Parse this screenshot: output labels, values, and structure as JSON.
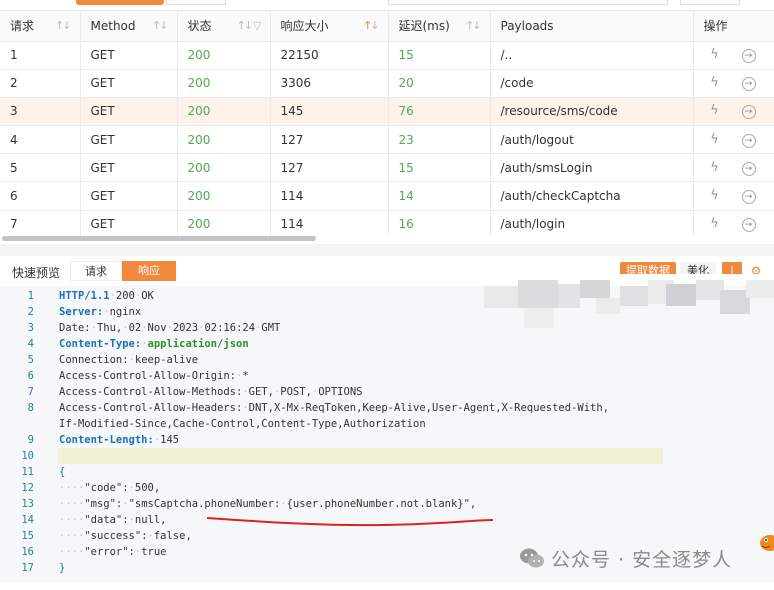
{
  "table": {
    "columns": [
      {
        "label": "请求",
        "sort": true,
        "filter": false
      },
      {
        "label": "Method",
        "sort": true,
        "filter": false
      },
      {
        "label": "状态",
        "sort": true,
        "filter": true
      },
      {
        "label": "响应大小",
        "sort": true,
        "filter": false,
        "sort_active": true
      },
      {
        "label": "延迟(ms)",
        "sort": true,
        "filter": false
      },
      {
        "label": "Payloads",
        "sort": false,
        "filter": false
      },
      {
        "label": "操作",
        "sort": false,
        "filter": false
      }
    ],
    "rows": [
      {
        "id": "1",
        "method": "GET",
        "status": "200",
        "size": "22150",
        "latency": "15",
        "payload": "/.."
      },
      {
        "id": "2",
        "method": "GET",
        "status": "200",
        "size": "3306",
        "latency": "20",
        "payload": "/code"
      },
      {
        "id": "3",
        "method": "GET",
        "status": "200",
        "size": "145",
        "latency": "76",
        "payload": "/resource/sms/code"
      },
      {
        "id": "4",
        "method": "GET",
        "status": "200",
        "size": "127",
        "latency": "23",
        "payload": "/auth/logout"
      },
      {
        "id": "5",
        "method": "GET",
        "status": "200",
        "size": "127",
        "latency": "15",
        "payload": "/auth/smsLogin"
      },
      {
        "id": "6",
        "method": "GET",
        "status": "200",
        "size": "114",
        "latency": "14",
        "payload": "/auth/checkCaptcha"
      },
      {
        "id": "7",
        "method": "GET",
        "status": "200",
        "size": "114",
        "latency": "16",
        "payload": "/auth/login"
      }
    ],
    "selected_row": 2
  },
  "preview": {
    "label": "快速预览",
    "tab_request": "请求",
    "tab_response": "响应",
    "btn_extract": "提取数据",
    "btn_beautify": "美化"
  },
  "code_lines": [
    {
      "n": "1",
      "parts": [
        [
          "k",
          "HTTP/1.1"
        ],
        [
          "d",
          "·"
        ],
        [
          "t",
          "200"
        ],
        [
          "d",
          "·"
        ],
        [
          "t",
          "OK"
        ]
      ]
    },
    {
      "n": "2",
      "parts": [
        [
          "k",
          "Server:"
        ],
        [
          "d",
          "·"
        ],
        [
          "t",
          "nginx"
        ]
      ]
    },
    {
      "n": "3",
      "parts": [
        [
          "t",
          "Date:"
        ],
        [
          "d",
          "·"
        ],
        [
          "t",
          "Thu,"
        ],
        [
          "d",
          "·"
        ],
        [
          "t",
          "02"
        ],
        [
          "d",
          "·"
        ],
        [
          "t",
          "Nov"
        ],
        [
          "d",
          "·"
        ],
        [
          "t",
          "2023"
        ],
        [
          "d",
          "·"
        ],
        [
          "t",
          "02:16:24"
        ],
        [
          "d",
          "·"
        ],
        [
          "t",
          "GMT"
        ]
      ]
    },
    {
      "n": "4",
      "parts": [
        [
          "k",
          "Content-Type:"
        ],
        [
          "d",
          "·"
        ],
        [
          "kv",
          "application/json"
        ]
      ]
    },
    {
      "n": "5",
      "parts": [
        [
          "t",
          "Connection:"
        ],
        [
          "d",
          "·"
        ],
        [
          "t",
          "keep-alive"
        ]
      ]
    },
    {
      "n": "6",
      "parts": [
        [
          "t",
          "Access-Control-Allow-Origin:"
        ],
        [
          "d",
          "·"
        ],
        [
          "t",
          "*"
        ]
      ]
    },
    {
      "n": "7",
      "parts": [
        [
          "t",
          "Access-Control-Allow-Methods:"
        ],
        [
          "d",
          "·"
        ],
        [
          "t",
          "GET,"
        ],
        [
          "d",
          "·"
        ],
        [
          "t",
          "POST,"
        ],
        [
          "d",
          "·"
        ],
        [
          "t",
          "OPTIONS"
        ]
      ]
    },
    {
      "n": "8",
      "parts": [
        [
          "t",
          "Access-Control-Allow-Headers:"
        ],
        [
          "d",
          "·"
        ],
        [
          "t",
          "DNT,X-Mx-ReqToken,Keep-Alive,User-Agent,X-Requested-With,"
        ]
      ]
    },
    {
      "n": "",
      "parts": [
        [
          "t",
          "If-Modified-Since,Cache-Control,Content-Type,Authorization"
        ]
      ]
    },
    {
      "n": "9",
      "parts": [
        [
          "k",
          "Content-Length:"
        ],
        [
          "d",
          "·"
        ],
        [
          "t",
          "145"
        ]
      ]
    },
    {
      "n": "10",
      "parts": [],
      "highlight": true
    },
    {
      "n": "11",
      "parts": [
        [
          "b",
          "{"
        ]
      ]
    },
    {
      "n": "12",
      "parts": [
        [
          "d",
          "····"
        ],
        [
          "t",
          "\"code\":"
        ],
        [
          "d",
          "·"
        ],
        [
          "t",
          "500,"
        ]
      ]
    },
    {
      "n": "13",
      "parts": [
        [
          "d",
          "····"
        ],
        [
          "t",
          "\"msg\":"
        ],
        [
          "d",
          "·"
        ],
        [
          "t",
          "\"smsCaptcha.phoneNumber:"
        ],
        [
          "d",
          "·"
        ],
        [
          "t",
          "{user.phoneNumber.not.blank}\","
        ]
      ]
    },
    {
      "n": "14",
      "parts": [
        [
          "d",
          "····"
        ],
        [
          "t",
          "\"data\":"
        ],
        [
          "d",
          "·"
        ],
        [
          "t",
          "null,"
        ]
      ]
    },
    {
      "n": "15",
      "parts": [
        [
          "d",
          "····"
        ],
        [
          "t",
          "\"success\":"
        ],
        [
          "d",
          "·"
        ],
        [
          "t",
          "false,"
        ]
      ]
    },
    {
      "n": "16",
      "parts": [
        [
          "d",
          "····"
        ],
        [
          "t",
          "\"error\":"
        ],
        [
          "d",
          "·"
        ],
        [
          "t",
          "true"
        ]
      ]
    },
    {
      "n": "17",
      "parts": [
        [
          "b",
          "}"
        ]
      ]
    }
  ],
  "watermark": "公众号 · 安全逐梦人",
  "colors": {
    "accent": "#f0883e",
    "status_ok": "#52a852",
    "key_blue": "#1c6fc2",
    "selected_row_bg": "#fdf3ea"
  }
}
